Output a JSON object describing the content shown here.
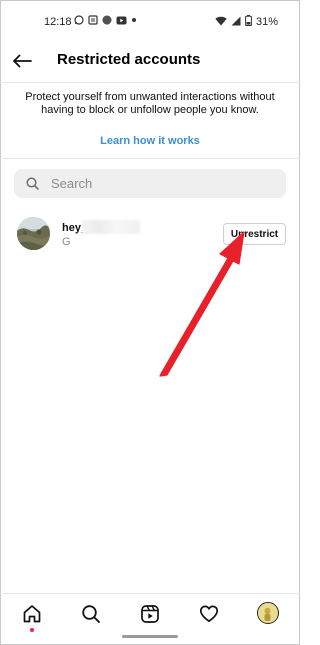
{
  "status_bar": {
    "time": "12:18",
    "battery": "31%",
    "left_icons": [
      "whatsapp-icon",
      "news-icon",
      "pinwheel-icon",
      "youtube-icon",
      "dot-icon"
    ],
    "right_icons": [
      "wifi-icon",
      "signal-icon",
      "battery-icon"
    ]
  },
  "header": {
    "title": "Restricted accounts",
    "back_icon": "back-arrow-icon"
  },
  "info": {
    "text": "Protect yourself from unwanted interactions without having to block or unfollow people you know.",
    "link": "Learn how it works"
  },
  "search": {
    "placeholder": "Search",
    "icon": "search-icon"
  },
  "accounts": [
    {
      "username": "hey_",
      "subname": "G",
      "button_label": "Unrestrict"
    }
  ],
  "bottom_nav": {
    "items": [
      "home-icon",
      "search-icon",
      "reels-icon",
      "heart-icon",
      "profile-avatar"
    ]
  },
  "colors": {
    "link": "#3b8fd6",
    "annotation_arrow": "#e8202a",
    "search_bg": "#efefef",
    "notification_dot": "#e0245e"
  }
}
